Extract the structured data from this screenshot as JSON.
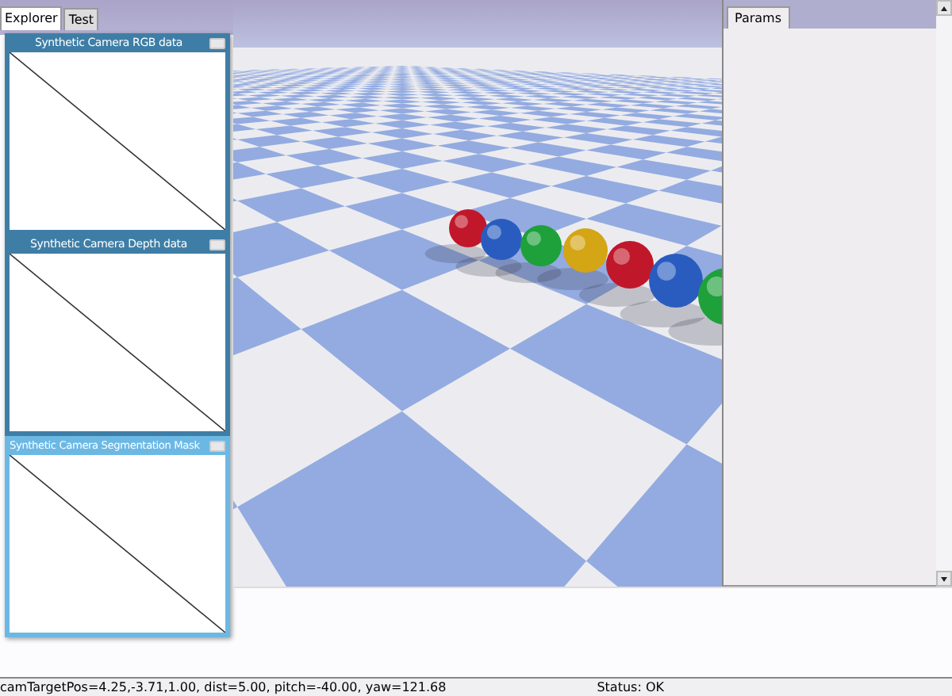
{
  "tabs": [
    {
      "label": "Explorer",
      "selected": true
    },
    {
      "label": "Test",
      "selected": false
    }
  ],
  "image_windows": [
    {
      "title": "Synthetic Camera RGB data",
      "selected": false
    },
    {
      "title": "Synthetic Camera Depth data",
      "selected": false
    },
    {
      "title": "Synthetic Camera Segmentation Mask",
      "selected": true
    }
  ],
  "params_panel": {
    "tab": "Params"
  },
  "status_bar": {
    "camera": "camTargetPos=4.25,-3.71,1.00, dist=5.00, pitch=-40.00, yaw=121.68",
    "status": "Status: OK"
  }
}
